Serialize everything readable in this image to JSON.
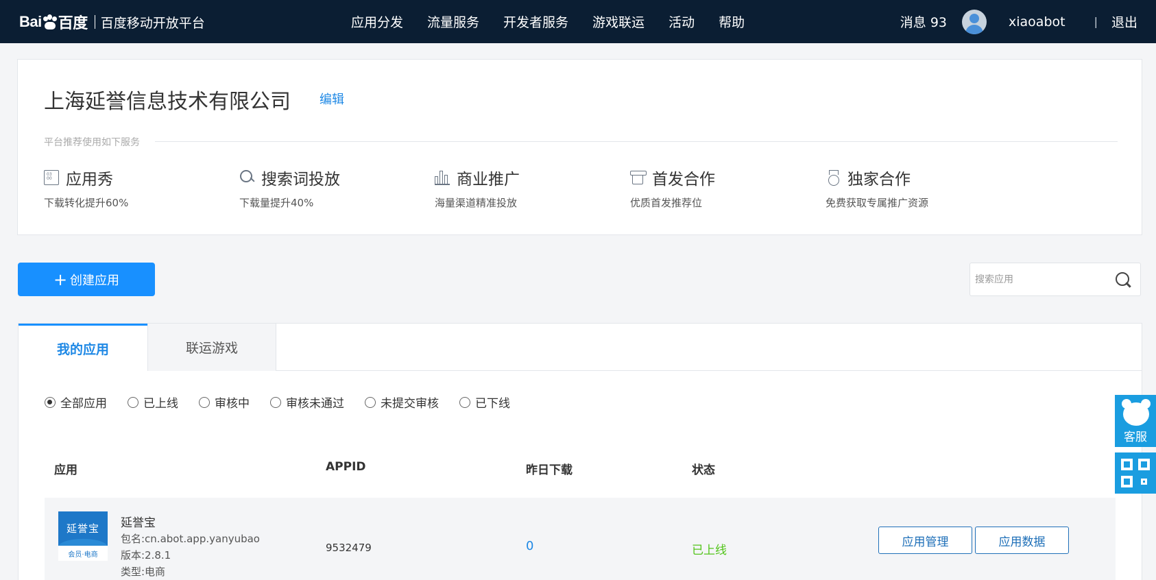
{
  "nav": {
    "logo_mark_left": "Bai",
    "logo_mark_right": "百度",
    "logo_sub": "百度移动开放平台",
    "items": [
      "应用分发",
      "流量服务",
      "开发者服务",
      "游戏联运",
      "活动",
      "帮助"
    ],
    "messages": "消息 93",
    "username": "xiaoabot",
    "separator": "|",
    "logout": "退出"
  },
  "company": {
    "name": "上海延誉信息技术有限公司",
    "edit": "编辑",
    "recommend_title": "平台推荐使用如下服务",
    "services": [
      {
        "icon": "grid-icon",
        "name": "应用秀",
        "desc": "下载转化提升60%"
      },
      {
        "icon": "search-icon",
        "name": "搜索词投放",
        "desc": "下载量提升40%"
      },
      {
        "icon": "bar-chart-icon",
        "name": "商业推广",
        "desc": "海量渠道精准投放"
      },
      {
        "icon": "cup-icon",
        "name": "首发合作",
        "desc": "优质首发推荐位"
      },
      {
        "icon": "medal-icon",
        "name": "独家合作",
        "desc": "免费获取专属推广资源"
      }
    ]
  },
  "toolbar": {
    "create_plus": "+",
    "create_label": "创建应用",
    "search_placeholder": "搜索应用"
  },
  "tabs": {
    "active": "我的应用",
    "inactive": "联运游戏"
  },
  "filters": [
    {
      "label": "全部应用",
      "checked": true
    },
    {
      "label": "已上线",
      "checked": false
    },
    {
      "label": "审核中",
      "checked": false
    },
    {
      "label": "审核未通过",
      "checked": false
    },
    {
      "label": "未提交审核",
      "checked": false
    },
    {
      "label": "已下线",
      "checked": false
    }
  ],
  "table": {
    "headers": {
      "app": "应用",
      "appid": "APPID",
      "downloads": "昨日下载",
      "status": "状态"
    },
    "rows": [
      {
        "logo_text": "延誉宝",
        "logo_sub": "会员·电商",
        "name": "延誉宝",
        "package": "包名:cn.abot.app.yanyubao",
        "version": "版本:2.8.1",
        "type": "类型:电商",
        "appid": "9532479",
        "downloads": "0",
        "status": "已上线",
        "actions": [
          "应用管理",
          "应用数据"
        ]
      }
    ]
  },
  "side": {
    "service_label": "客服"
  },
  "colors": {
    "nav_bg": "#0b1e33",
    "primary": "#1890ff",
    "link": "#1e88e5",
    "status_online": "#52c41a",
    "side_bg": "#1a9de0"
  }
}
